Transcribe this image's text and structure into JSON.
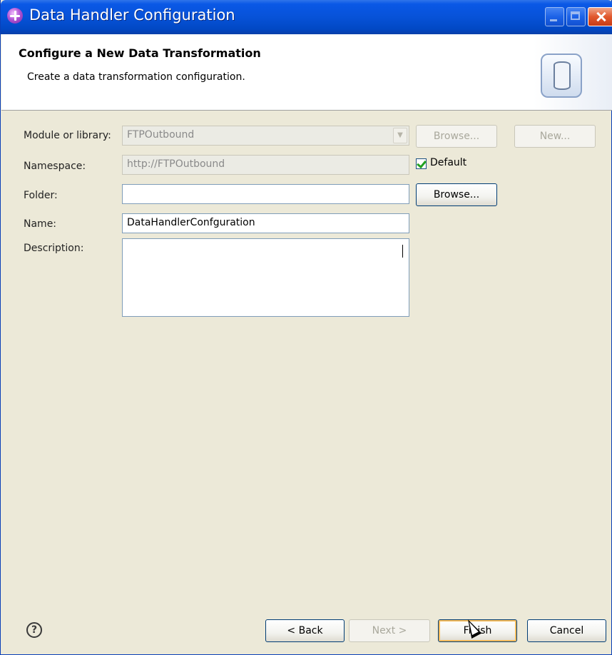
{
  "window": {
    "title": "Data Handler Configuration"
  },
  "header": {
    "title": "Configure a New Data Transformation",
    "subtitle": "Create a data transformation configuration."
  },
  "form": {
    "module_label": "Module or library:",
    "module_value": "FTPOutbound",
    "module_browse": "Browse...",
    "module_new": "New...",
    "namespace_label": "Namespace:",
    "namespace_value": "http://FTPOutbound",
    "default_label": "Default",
    "folder_label": "Folder:",
    "folder_value": "",
    "folder_browse": "Browse...",
    "name_label": "Name:",
    "name_value": "DataHandlerConfguration",
    "description_label": "Description:",
    "description_value": ""
  },
  "footer": {
    "help": "?",
    "back": "< Back",
    "next": "Next >",
    "finish": "Finish",
    "cancel": "Cancel"
  },
  "icons": {
    "app": "eclipse-purple-icon",
    "wizard": "database-cylinder-icon"
  },
  "colors": {
    "titlebar": "#0752d8",
    "close": "#e1582d",
    "body": "#ece9d8",
    "check": "#21a121"
  }
}
